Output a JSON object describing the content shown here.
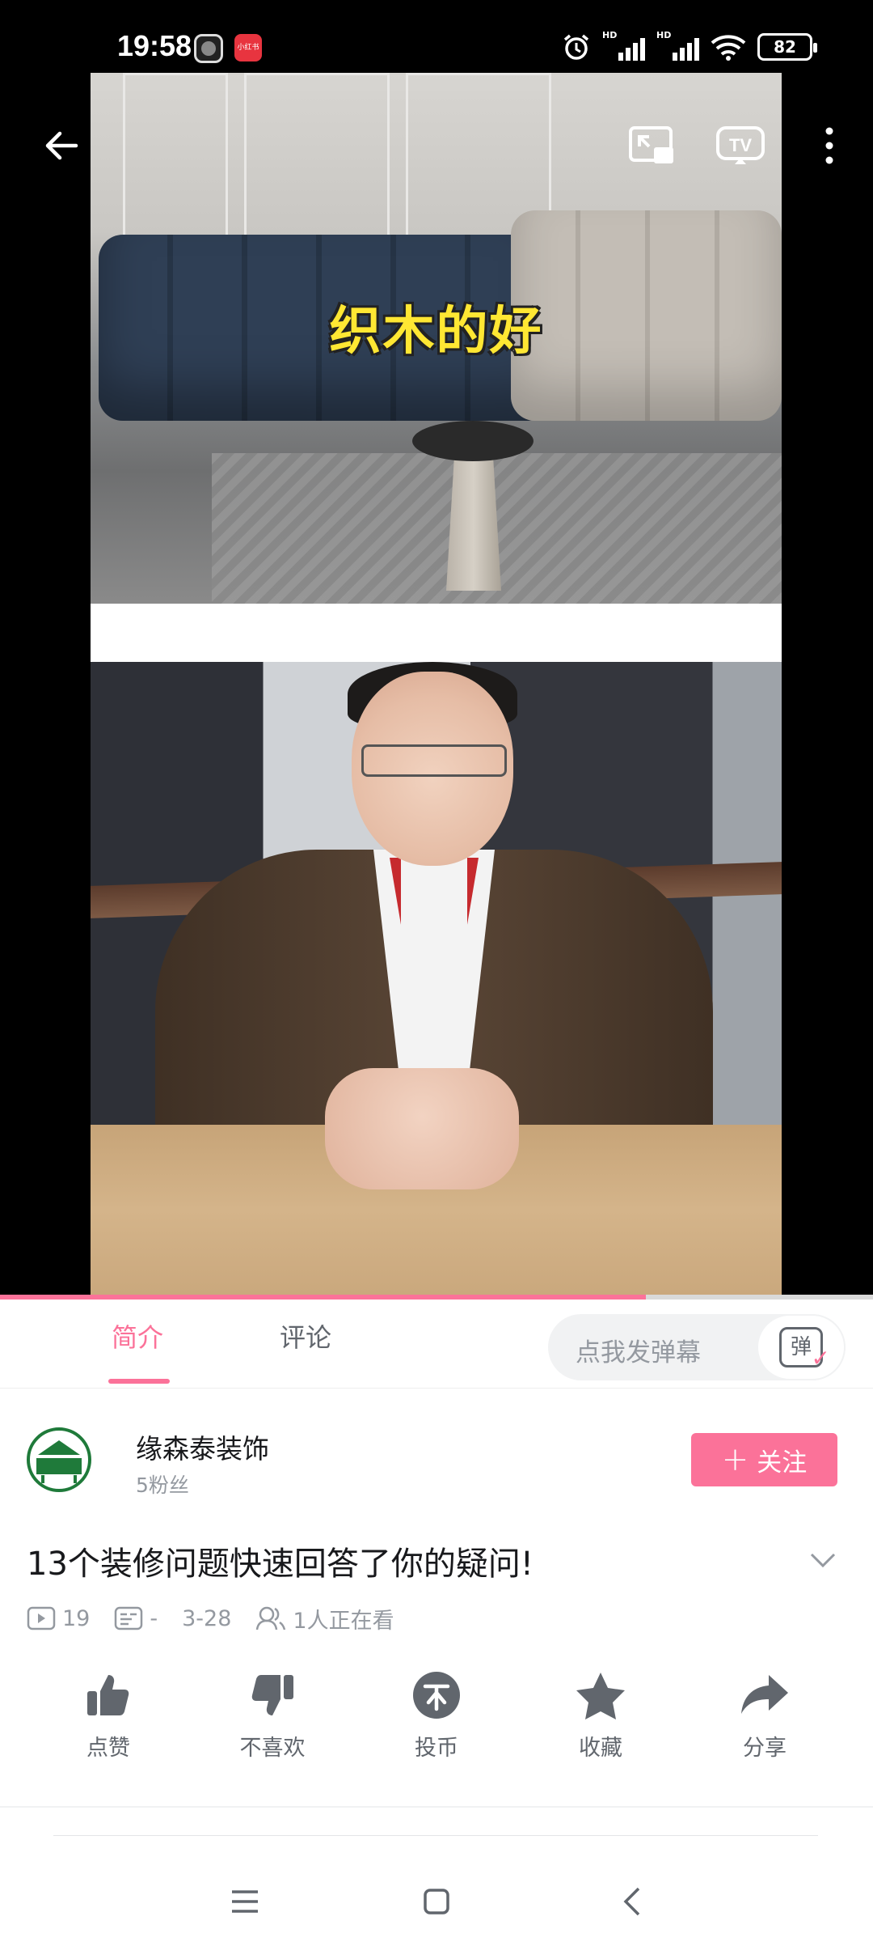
{
  "status_bar": {
    "time": "19:58",
    "app_badge": "小红书",
    "hd1": "HD",
    "hd2": "HD",
    "battery": "82"
  },
  "player": {
    "overlay_caption": "织木的好",
    "progress": 0.74,
    "icons": [
      "back-arrow-icon",
      "pip-icon",
      "tv-cast-icon",
      "more-icon"
    ]
  },
  "tabs": {
    "intro": "简介",
    "comments": "评论",
    "danmaku_placeholder": "点我发弹幕",
    "danmaku_icon_text": "弹"
  },
  "author": {
    "name": "缘森泰装饰",
    "fans": "5粉丝",
    "follow_label": "关注",
    "follow_plus": "+"
  },
  "video": {
    "title": "13个装修问题快速回答了你的疑问!",
    "views": "19",
    "danmaku_count": "-",
    "date": "3-28",
    "watching": "1人正在看"
  },
  "actions": {
    "like": "点赞",
    "dislike": "不喜欢",
    "coin": "投币",
    "favorite": "收藏",
    "share": "分享"
  },
  "colors": {
    "accent": "#fb7299",
    "text_primary": "#18191c",
    "text_secondary": "#9499a0"
  }
}
